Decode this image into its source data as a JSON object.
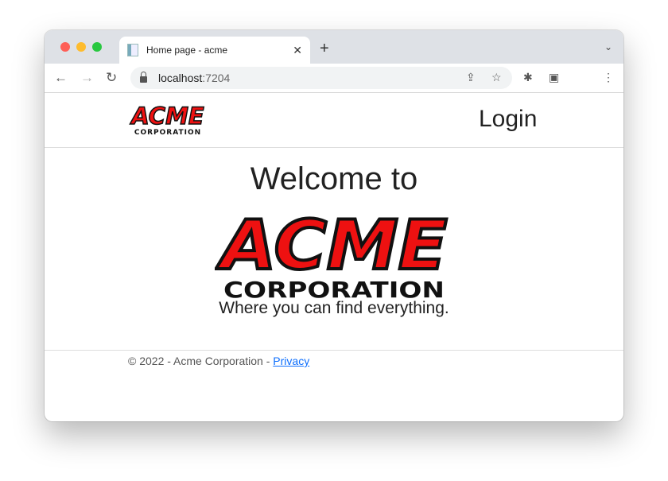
{
  "browser": {
    "tab_title": "Home page - acme",
    "url_host": "localhost",
    "url_port": ":7204"
  },
  "header": {
    "logo_text": "ACME",
    "logo_subtext": "CORPORATION",
    "login_label": "Login"
  },
  "main": {
    "welcome": "Welcome to",
    "logo_text": "ACME",
    "logo_subtext": "CORPORATION",
    "tagline": "Where you can find everything."
  },
  "footer": {
    "copyright": "© 2022 - Acme Corporation - ",
    "privacy_label": "Privacy"
  },
  "colors": {
    "logo_red": "#ee1111",
    "link": "#0d6efd"
  }
}
